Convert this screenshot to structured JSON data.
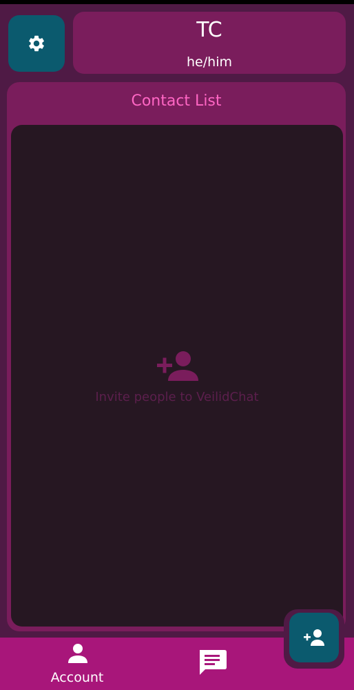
{
  "profile": {
    "name": "TC",
    "pronouns": "he/him"
  },
  "contact_list": {
    "title": "Contact List",
    "empty_message": "Invite people to VeilidChat"
  },
  "bottom_nav": {
    "items": [
      {
        "label": "Account",
        "icon": "person-icon"
      },
      {
        "label": "",
        "icon": "chat-icon"
      }
    ]
  },
  "actions": {
    "settings_icon": "gear-icon",
    "add_contact_icon": "person-add-icon"
  },
  "colors": {
    "background": "#4f1a45",
    "card": "#7a1d5c",
    "list_background": "#261722",
    "accent_teal": "#0b5a6e",
    "title_pink": "#ff66c4",
    "nav_bar": "#a8167a"
  }
}
